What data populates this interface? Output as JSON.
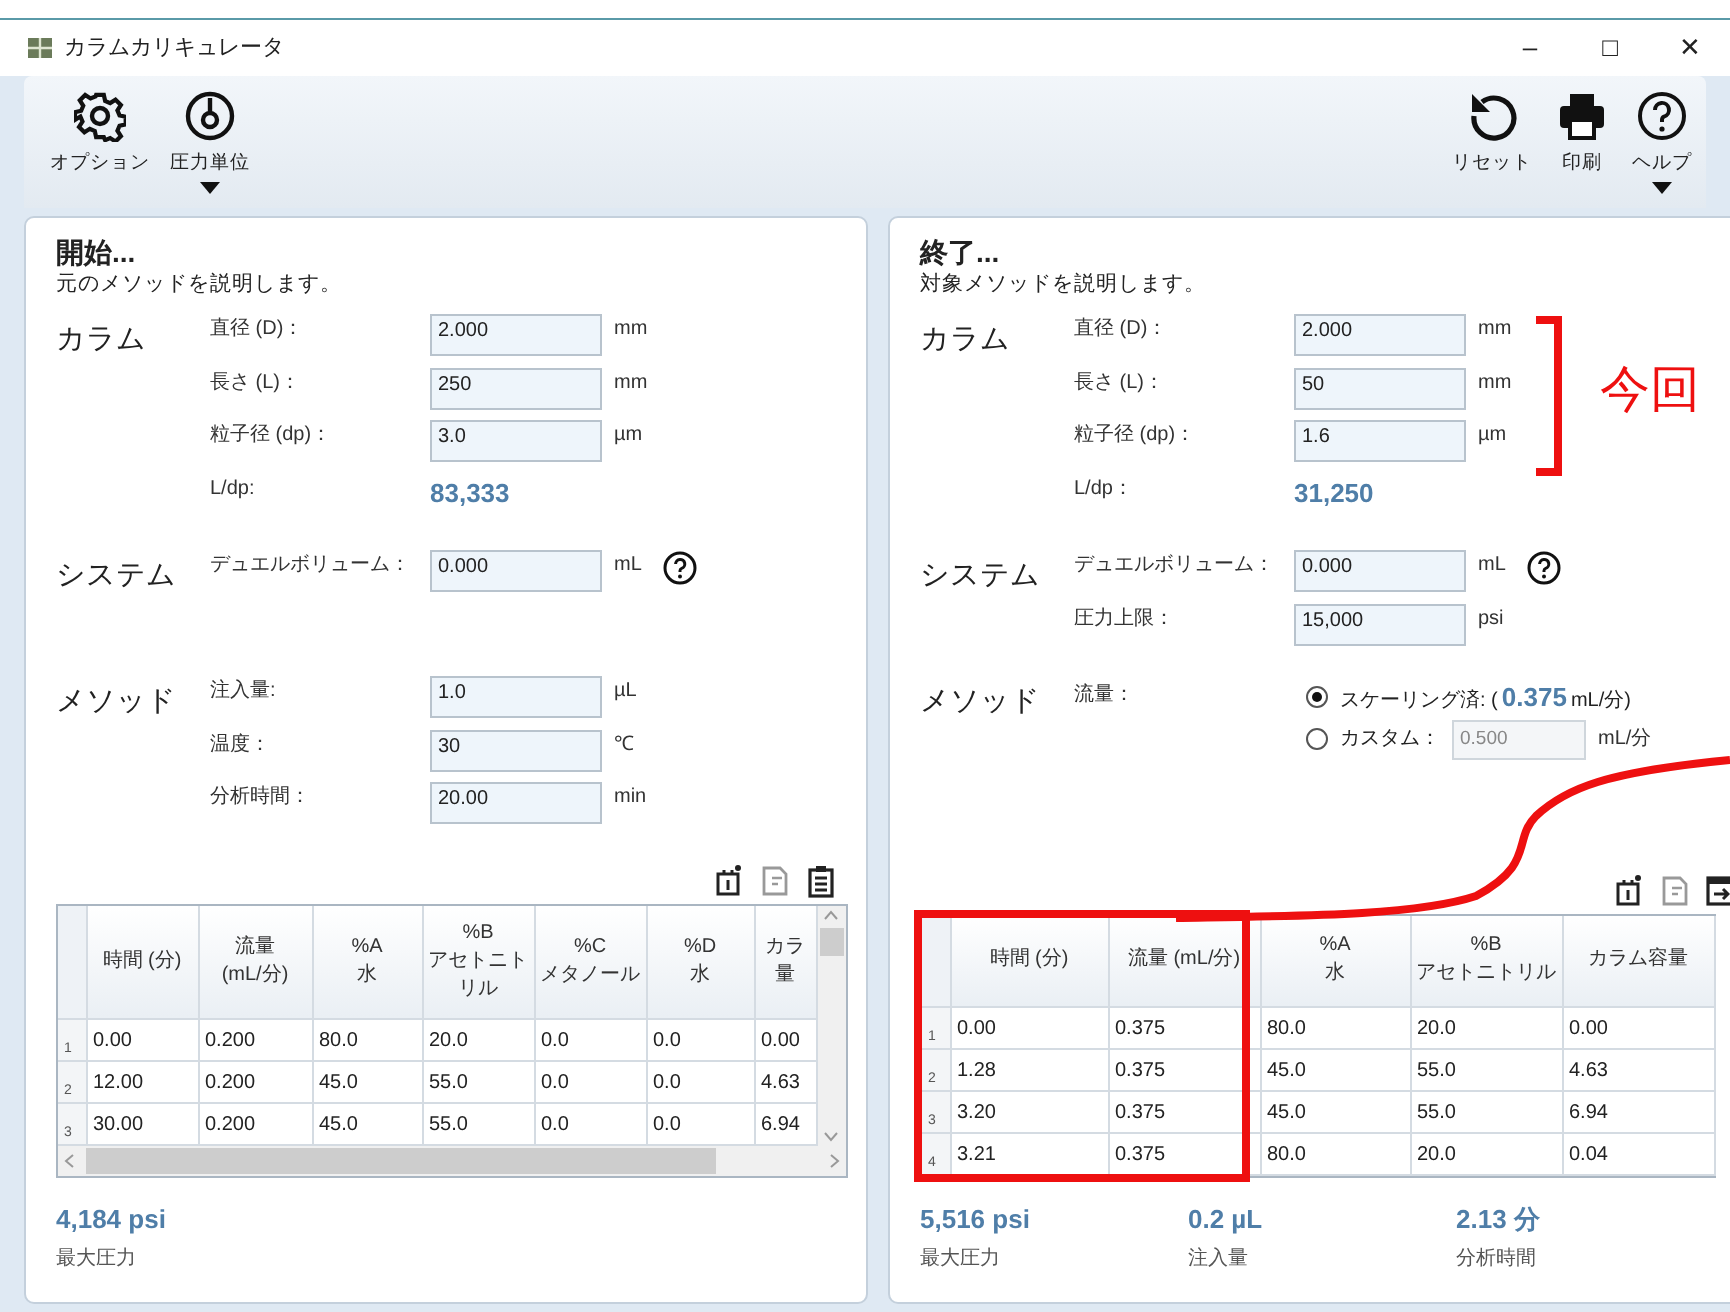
{
  "window": {
    "title": "カラムカリキュレータ",
    "controls": [
      "–",
      "□",
      "✕"
    ]
  },
  "toolbar_left": [
    {
      "kind": "gear",
      "label": "オプション",
      "dropdown": false
    },
    {
      "kind": "gauge",
      "label": "圧力単位",
      "dropdown": true
    }
  ],
  "toolbar_right": [
    {
      "kind": "reset",
      "label": "リセット",
      "dropdown": false
    },
    {
      "kind": "print",
      "label": "印刷",
      "dropdown": false
    },
    {
      "kind": "help",
      "label": "ヘルプ",
      "dropdown": true
    }
  ],
  "panels": [
    {
      "title": "開始...",
      "description": "元のメソッドを説明します。",
      "groups": [
        {
          "heading": "カラム",
          "rows": [
            {
              "kind": "field",
              "label": "直径 (D)：",
              "value": "2.000",
              "unit": "mm"
            },
            {
              "kind": "field",
              "label": "長さ (L)：",
              "value": "250",
              "unit": "mm"
            },
            {
              "kind": "field",
              "label": "粒子径 (dp)：",
              "value": "3.0",
              "unit": "µm"
            },
            {
              "kind": "readout",
              "label": "L/dp:",
              "value": "83,333"
            }
          ]
        },
        {
          "heading": "システム",
          "rows": [
            {
              "kind": "field",
              "label": "デュエルボリューム：",
              "value": "0.000",
              "unit": "mL",
              "help": true
            }
          ]
        },
        {
          "heading": "メソッド",
          "rows": [
            {
              "kind": "field",
              "label": "注入量:",
              "value": "1.0",
              "unit": "µL"
            },
            {
              "kind": "field",
              "label": "温度：",
              "value": "30",
              "unit": "℃"
            },
            {
              "kind": "field",
              "label": "分析時間：",
              "value": "20.00",
              "unit": "min"
            }
          ]
        }
      ],
      "table_tools": [
        {
          "kind": "delete"
        },
        {
          "kind": "copy"
        },
        {
          "kind": "paste"
        }
      ],
      "table": {
        "scrollbars": true,
        "columns": [
          "時間 (分)",
          "流量\n(mL/分)",
          "%A\n水",
          "%B\nアセトニトリル",
          "%C\nメタノール",
          "%D\n水",
          "カラ量"
        ],
        "rows": [
          {
            "number": "1",
            "cells": [
              "0.00",
              "0.200",
              "80.0",
              "20.0",
              "0.0",
              "0.0",
              "0.00"
            ]
          },
          {
            "number": "2",
            "cells": [
              "12.00",
              "0.200",
              "45.0",
              "55.0",
              "0.0",
              "0.0",
              "4.63"
            ]
          },
          {
            "number": "3",
            "cells": [
              "30.00",
              "0.200",
              "45.0",
              "55.0",
              "0.0",
              "0.0",
              "6.94"
            ]
          }
        ]
      },
      "summary": [
        {
          "value": "4,184 psi",
          "label": "最大圧力"
        }
      ]
    },
    {
      "title": "終了...",
      "description": "対象メソッドを説明します。",
      "groups": [
        {
          "heading": "カラム",
          "rows": [
            {
              "kind": "field",
              "label": "直径 (D)：",
              "value": "2.000",
              "unit": "mm"
            },
            {
              "kind": "field",
              "label": "長さ (L)：",
              "value": "50",
              "unit": "mm"
            },
            {
              "kind": "field",
              "label": "粒子径 (dp)：",
              "value": "1.6",
              "unit": "µm"
            },
            {
              "kind": "readout",
              "label": "L/dp：",
              "value": "31,250"
            }
          ]
        },
        {
          "heading": "システム",
          "rows": [
            {
              "kind": "field",
              "label": "デュエルボリューム：",
              "value": "0.000",
              "unit": "mL",
              "help": true
            },
            {
              "kind": "field",
              "label": "圧力上限：",
              "value": "15,000",
              "unit": "psi"
            }
          ]
        },
        {
          "heading": "メソッド",
          "rows": [
            {
              "kind": "radio",
              "label": "流量：",
              "options": [
                {
                  "kind": "readout",
                  "selected": true,
                  "label": "スケーリング済: (",
                  "value": "0.375",
                  "unit": "mL/分)"
                },
                {
                  "kind": "input",
                  "selected": false,
                  "label": "カスタム：",
                  "value": "0.500",
                  "unit": "mL/分",
                  "disabled": true
                }
              ]
            }
          ]
        }
      ],
      "table_tools": [
        {
          "kind": "delete"
        },
        {
          "kind": "copy"
        },
        {
          "kind": "export"
        }
      ],
      "table": {
        "scrollbars": false,
        "columns": [
          "時間 (分)",
          "流量 (mL/分)",
          "%A\n水",
          "%B\nアセトニトリル",
          "カラム容量"
        ],
        "rows": [
          {
            "number": "1",
            "cells": [
              "0.00",
              "0.375",
              "80.0",
              "20.0",
              "0.00"
            ]
          },
          {
            "number": "2",
            "cells": [
              "1.28",
              "0.375",
              "45.0",
              "55.0",
              "4.63"
            ]
          },
          {
            "number": "3",
            "cells": [
              "3.20",
              "0.375",
              "45.0",
              "55.0",
              "6.94"
            ]
          },
          {
            "number": "4",
            "cells": [
              "3.21",
              "0.375",
              "80.0",
              "20.0",
              "0.04"
            ]
          }
        ]
      },
      "summary": [
        {
          "value": "5,516 psi",
          "label": "最大圧力"
        },
        {
          "value": "0.2 µL",
          "label": "注入量"
        },
        {
          "value": "2.13 分",
          "label": "分析時間"
        }
      ]
    }
  ],
  "annotation": {
    "text": "今回"
  }
}
